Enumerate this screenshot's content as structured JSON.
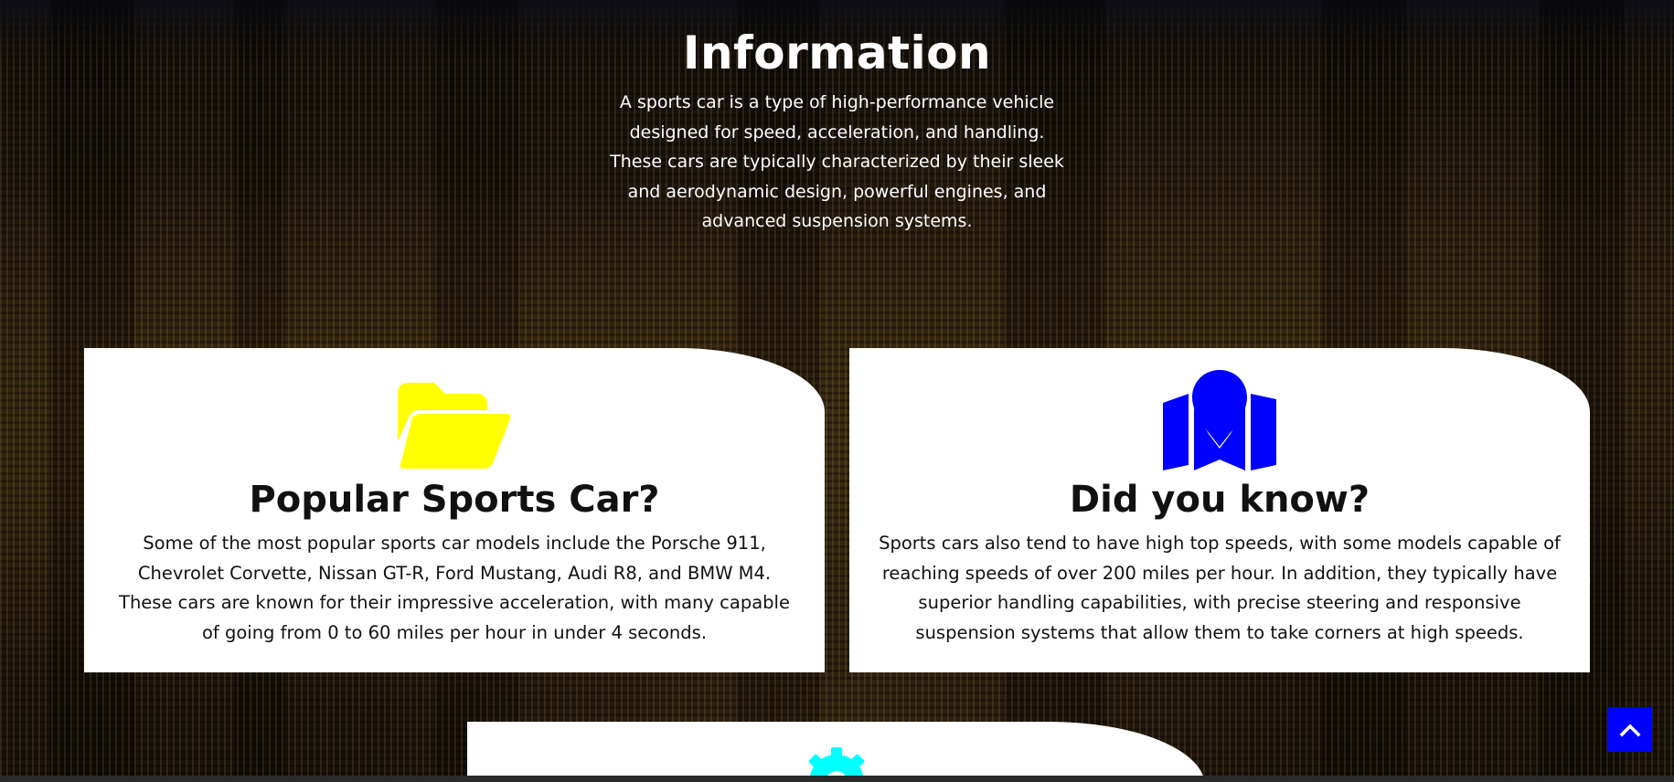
{
  "information": {
    "title": "Information",
    "description": "A sports car is a type of high-performance vehicle designed for speed, acceleration, and handling. These cars are typically characterized by their sleek and aerodynamic design, powerful engines, and advanced suspension systems."
  },
  "cards": [
    {
      "icon": "folder-open-icon",
      "icon_color": "#ffff00",
      "title": "Popular Sports Car?",
      "text": "Some of the most popular sports car models include the Porsche 911, Chevrolet Corvette, Nissan GT-R, Ford Mustang, Audi R8, and BMW M4. These cars are known for their impressive acceleration, with many capable of going from 0 to 60 miles per hour in under 4 seconds."
    },
    {
      "icon": "map-location-icon",
      "icon_color": "#0000ff",
      "title": "Did you know?",
      "text": "Sports cars also tend to have high top speeds, with some models capable of reaching speeds of over 200 miles per hour. In addition, they typically have superior handling capabilities, with precise steering and responsive suspension systems that allow them to take corners at high speeds."
    },
    {
      "icon": "gear-icon",
      "icon_color": "#00ffff"
    }
  ],
  "back_to_top": {
    "icon": "chevron-up-icon",
    "color": "#0000ff"
  }
}
